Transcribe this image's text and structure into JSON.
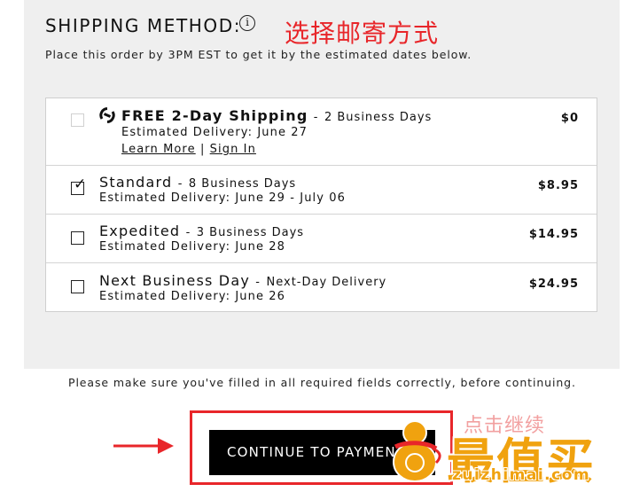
{
  "heading": "SHIPPING METHOD:",
  "info_icon_glyph": "i",
  "annotation_cn": "选择邮寄方式",
  "subtitle": "Place this order by 3PM EST to get it by the estimated dates below.",
  "options": [
    {
      "name": "FREE 2-Day Shipping",
      "separator": "-",
      "days": "2 Business Days",
      "estimate": "Estimated Delivery: June 27",
      "price": "$0",
      "checked": false,
      "disabled": true,
      "links": {
        "learn_more": "Learn More",
        "divider": "|",
        "sign_in": "Sign In"
      }
    },
    {
      "name": "Standard",
      "separator": "-",
      "days": "8 Business Days",
      "estimate": "Estimated Delivery: June 29 - July 06",
      "price": "$8.95",
      "checked": true,
      "disabled": false
    },
    {
      "name": "Expedited",
      "separator": "-",
      "days": "3 Business Days",
      "estimate": "Estimated Delivery: June 28",
      "price": "$14.95",
      "checked": false,
      "disabled": false
    },
    {
      "name": "Next Business Day",
      "separator": "-",
      "days": "Next-Day Delivery",
      "estimate": "Estimated Delivery: June 26",
      "price": "$24.95",
      "checked": false,
      "disabled": false
    }
  ],
  "notice": "Please make sure you've filled in all required fields correctly, before continuing.",
  "continue_label": "CONTINUE TO PAYMENT",
  "checkmark_glyph": "✓",
  "watermark": {
    "text_cn": "最值买",
    "domain": "zuizhimai.com",
    "faint_cn": "点击继续"
  },
  "colors": {
    "annotation_red": "#e8262a",
    "button_bg": "#000000",
    "panel_bg": "#efefef",
    "watermark_orange": "#f0a20f"
  }
}
